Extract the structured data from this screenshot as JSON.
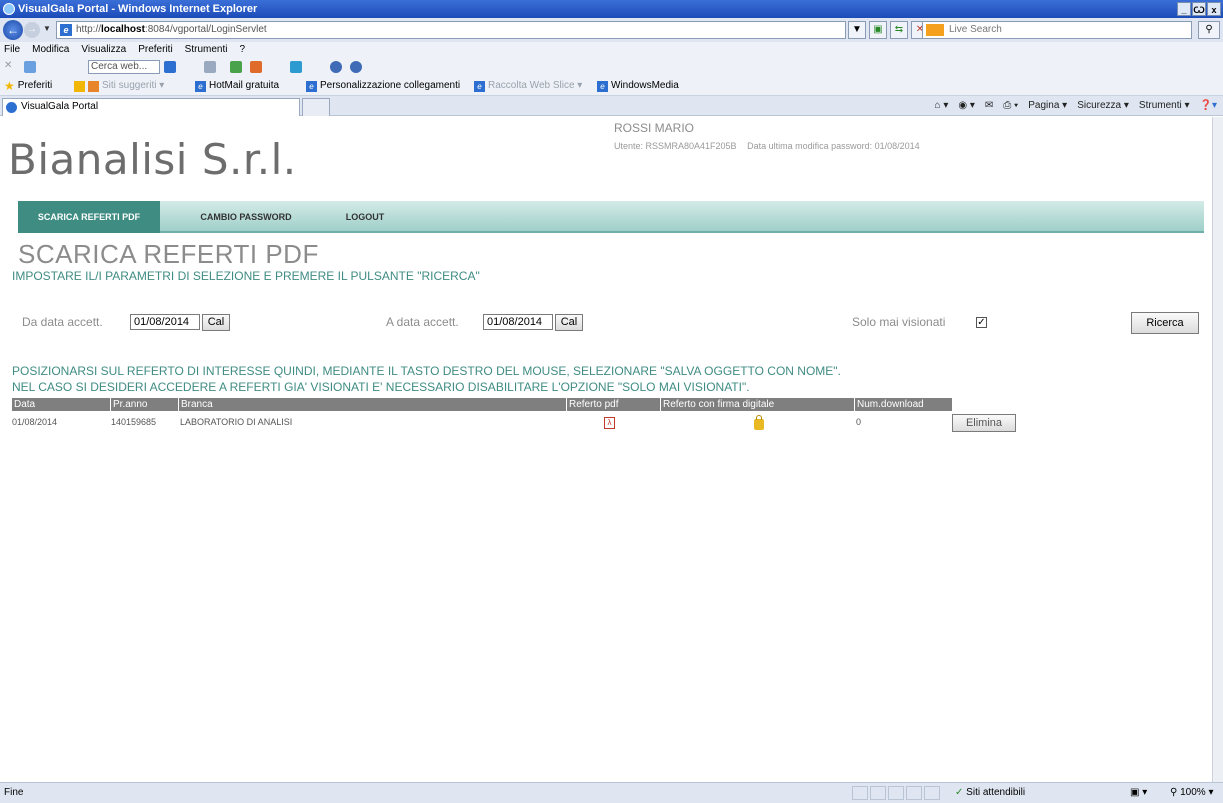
{
  "window": {
    "title": "VisualGala Portal - Windows Internet Explorer",
    "min": "_",
    "max": "Ѡ",
    "close": "x"
  },
  "address": {
    "url_prefix": "http://",
    "url_host": "localhost",
    "url_rest": ":8084/vgportal/LoginServlet",
    "search_placeholder": "Live Search"
  },
  "menu": [
    "File",
    "Modifica",
    "Visualizza",
    "Preferiti",
    "Strumenti",
    "?"
  ],
  "toolbar2": {
    "cerca_placeholder": "Cerca web..."
  },
  "favorites": {
    "label": "Preferiti",
    "items": [
      "Siti suggeriti ▾",
      "HotMail gratuita",
      "Personalizzazione collegamenti",
      "Raccolta Web Slice ▾",
      "WindowsMedia"
    ]
  },
  "tab": {
    "title": "VisualGala Portal"
  },
  "commands": [
    "Pagina ▾",
    "Sicurezza ▾",
    "Strumenti ▾"
  ],
  "page": {
    "company": "Bianalisi S.r.l.",
    "user_name": "ROSSI MARIO",
    "user_code": "Utente: RSSMRA80A41F205B",
    "pwd_change": "Data ultima modifica password: 01/08/2014",
    "nav": [
      "SCARICA REFERTI PDF",
      "CAMBIO PASSWORD",
      "LOGOUT"
    ],
    "title": "SCARICA REFERTI PDF",
    "subtitle": "IMPOSTARE IL/I PARAMETRI DI SELEZIONE E PREMERE IL PULSANTE \"RICERCA\"",
    "filters": {
      "from_label": "Da data accett.",
      "from_value": "01/08/2014",
      "to_label": "A data accett.",
      "to_value": "01/08/2014",
      "cal_label": "Cal",
      "unseen_label": "Solo mai visionati",
      "unseen_checked": true,
      "search_label": "Ricerca"
    },
    "instructions": [
      "POSIZIONARSI SUL REFERTO DI INTERESSE QUINDI, MEDIANTE IL TASTO DESTRO DEL MOUSE, SELEZIONARE \"SALVA OGGETTO CON NOME\".",
      "NEL CASO SI DESIDERI ACCEDERE A REFERTI GIA' VISIONATI E' NECESSARIO DISABILITARE L'OPZIONE \"SOLO MAI VISIONATI\"."
    ],
    "columns": [
      "Data",
      "Pr.anno",
      "Branca",
      "Referto pdf",
      "Referto con firma digitale",
      "Num.download"
    ],
    "rows": [
      {
        "data": "01/08/2014",
        "pranno": "140159685",
        "branca": "LABORATORIO DI ANALISI",
        "downloads": "0",
        "delete_label": "Elimina"
      }
    ]
  },
  "status": {
    "left": "Fine",
    "zone": "Siti attendibili",
    "zoom": "100%"
  }
}
